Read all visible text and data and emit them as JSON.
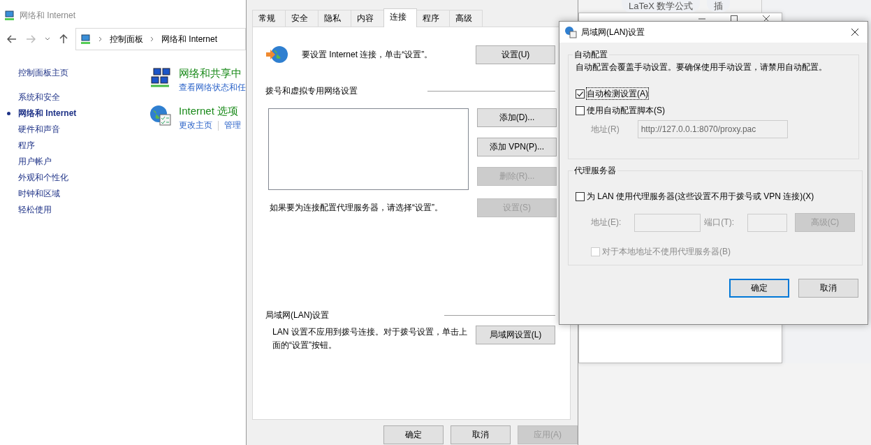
{
  "control_panel": {
    "title": "网络和 Internet",
    "breadcrumb": [
      "控制面板",
      "网络和 Internet"
    ],
    "home_link": "控制面板主页",
    "sidebar": [
      {
        "label": "系统和安全",
        "selected": false
      },
      {
        "label": "网络和 Internet",
        "selected": true
      },
      {
        "label": "硬件和声音",
        "selected": false
      },
      {
        "label": "程序",
        "selected": false
      },
      {
        "label": "用户帐户",
        "selected": false
      },
      {
        "label": "外观和个性化",
        "selected": false
      },
      {
        "label": "时钟和区域",
        "selected": false
      },
      {
        "label": "轻松使用",
        "selected": false
      }
    ],
    "categories": [
      {
        "kind": "network",
        "title": "网络和共享中",
        "links": [
          "查看网络状态和任"
        ]
      },
      {
        "kind": "internet",
        "title": "Internet 选项",
        "links": [
          "更改主页",
          "管理"
        ]
      }
    ]
  },
  "background_tabs": [
    "LaTeX 数学公式",
    "插"
  ],
  "internet_options": {
    "tabs": [
      {
        "label": "常规",
        "selected": false
      },
      {
        "label": "安全",
        "selected": false
      },
      {
        "label": "隐私",
        "selected": false
      },
      {
        "label": "内容",
        "selected": false
      },
      {
        "label": "连接",
        "selected": true
      },
      {
        "label": "程序",
        "selected": false
      },
      {
        "label": "高级",
        "selected": false
      }
    ],
    "setup_text": "要设置 Internet 连接，单击“设置”。",
    "setup_button": "设置(U)",
    "dialup_heading": "拨号和虚拟专用网络设置",
    "dialup_buttons": [
      {
        "label": "添加(D)...",
        "disabled": false
      },
      {
        "label": "添加 VPN(P)...",
        "disabled": false
      },
      {
        "label": "删除(R)...",
        "disabled": true
      }
    ],
    "proxy_text": "如果要为连接配置代理服务器，请选择“设置”。",
    "proxy_button": {
      "label": "设置(S)",
      "disabled": true
    },
    "lan_heading": "局域网(LAN)设置",
    "lan_text": "LAN 设置不应用到拨号连接。对于拨号设置，单击上面的“设置”按钮。",
    "lan_button": "局域网设置(L)",
    "footer_buttons": [
      {
        "label": "确定",
        "disabled": false
      },
      {
        "label": "取消",
        "disabled": false
      },
      {
        "label": "应用(A)",
        "disabled": true
      }
    ]
  },
  "lan_dialog": {
    "title": "局域网(LAN)设置",
    "auto_group": "自动配置",
    "auto_text": "自动配置会覆盖手动设置。要确保使用手动设置，请禁用自动配置。",
    "auto_options": [
      {
        "label": "自动检测设置(A)",
        "checked": true,
        "disabled": false
      },
      {
        "label": "使用自动配置脚本(S)",
        "checked": false,
        "disabled": false
      }
    ],
    "script_address": {
      "label": "地址(R)",
      "value": "http://127.0.0.1:8070/proxy.pac",
      "disabled": true
    },
    "proxy_group": "代理服务器",
    "use_proxy": {
      "label": "为 LAN 使用代理服务器(这些设置不用于拨号或 VPN 连接)(X)",
      "checked": false,
      "disabled": false
    },
    "address_label": "地址(E):",
    "port_label": "端口(T):",
    "advanced_button": {
      "label": "高级(C)",
      "disabled": true
    },
    "bypass": {
      "label": "对于本地地址不使用代理服务器(B)",
      "checked": false,
      "disabled": true
    },
    "buttons": [
      {
        "label": "确定",
        "default": true
      },
      {
        "label": "取消",
        "default": false
      }
    ]
  }
}
